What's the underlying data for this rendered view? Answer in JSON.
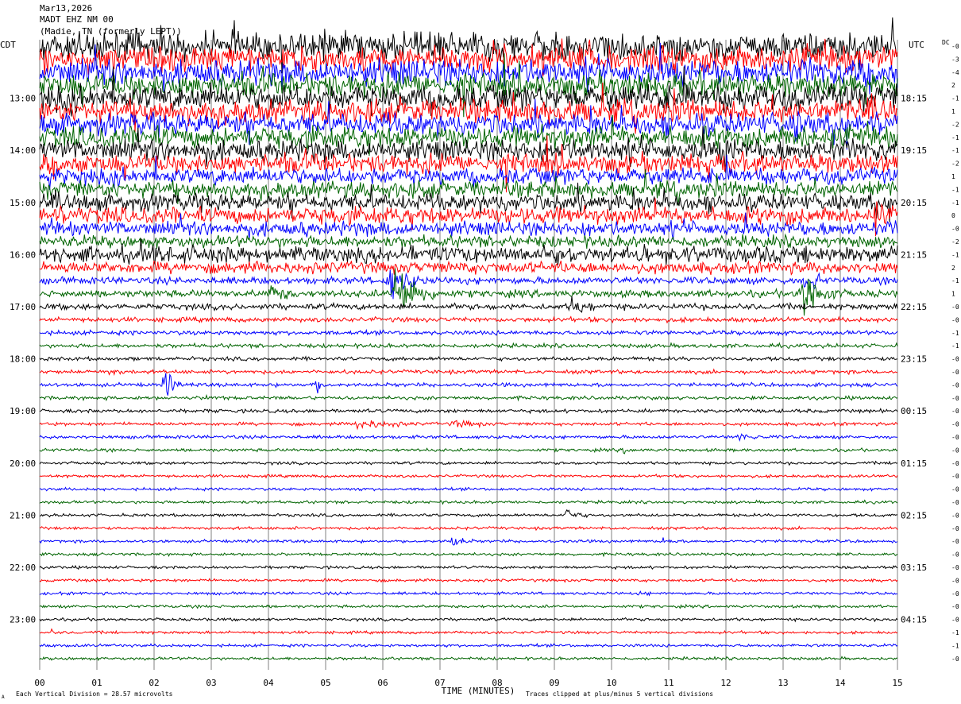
{
  "header": {
    "date": "Mar13,2026",
    "station": "MADT EHZ NM 00",
    "location": "(Madie, TN (formerly LEPT))"
  },
  "labels": {
    "left_tz": "CDT",
    "right_tz": "UTC",
    "dc": "DC",
    "x_axis_title": "TIME (MINUTES)",
    "scale_note": "Each Vertical Division =   28.57 microvolts",
    "clip_note": "Traces clipped at plus/minus 5 vertical divisions",
    "corner_mark": "A"
  },
  "colors": {
    "cycle": [
      "#000000",
      "#ff0000",
      "#0000ff",
      "#006400"
    ],
    "grid": "#808080"
  },
  "chart_data": {
    "type": "helicorder",
    "minutes_per_line": 15,
    "lines": 48,
    "x_ticks": [
      "00",
      "01",
      "02",
      "03",
      "04",
      "05",
      "06",
      "07",
      "08",
      "09",
      "10",
      "11",
      "12",
      "13",
      "14",
      "15"
    ],
    "xlim": [
      0,
      15
    ],
    "left_time_labels": [
      {
        "line": 4,
        "label": "13:00"
      },
      {
        "line": 8,
        "label": "14:00"
      },
      {
        "line": 12,
        "label": "15:00"
      },
      {
        "line": 16,
        "label": "16:00"
      },
      {
        "line": 20,
        "label": "17:00"
      },
      {
        "line": 24,
        "label": "18:00"
      },
      {
        "line": 28,
        "label": "19:00"
      },
      {
        "line": 32,
        "label": "20:00"
      },
      {
        "line": 36,
        "label": "21:00"
      },
      {
        "line": 40,
        "label": "22:00"
      },
      {
        "line": 44,
        "label": "23:00"
      }
    ],
    "right_time_labels": [
      {
        "line": 4,
        "label": "18:15"
      },
      {
        "line": 8,
        "label": "19:15"
      },
      {
        "line": 12,
        "label": "20:15"
      },
      {
        "line": 16,
        "label": "21:15"
      },
      {
        "line": 20,
        "label": "22:15"
      },
      {
        "line": 24,
        "label": "23:15"
      },
      {
        "line": 28,
        "label": "00:15"
      },
      {
        "line": 32,
        "label": "01:15"
      },
      {
        "line": 36,
        "label": "02:15"
      },
      {
        "line": 40,
        "label": "03:15"
      },
      {
        "line": 44,
        "label": "04:15"
      }
    ],
    "dc_offsets": [
      "-0",
      "-3",
      "-4",
      "2",
      "-1",
      "1",
      "-2",
      "-1",
      "-1",
      "-2",
      "1",
      "-1",
      "-1",
      "0",
      "-0",
      "-2",
      "-1",
      "2",
      "-1",
      "1",
      "-0",
      "-0",
      "-1",
      "-1",
      "-0",
      "-0",
      "-0",
      "-0",
      "-0",
      "-0",
      "-0",
      "-0",
      "-0",
      "-0",
      "-0",
      "-0",
      "-0",
      "-0",
      "-0",
      "-0",
      "-0",
      "-0",
      "-0",
      "-0",
      "-0",
      "-1",
      "-1",
      "-0"
    ],
    "noise_amplitude": [
      12,
      11,
      11,
      10,
      11,
      10,
      9,
      9,
      9,
      8,
      7,
      7,
      7,
      7,
      6,
      5,
      7,
      5,
      3,
      3,
      2.5,
      2,
      1.8,
      1.7,
      1.6,
      1.6,
      1.6,
      1.5,
      1.5,
      1.4,
      1.4,
      1.3,
      1.2,
      1.2,
      1.2,
      1.2,
      1.2,
      1.2,
      1.2,
      1.2,
      1.2,
      1.2,
      1.2,
      1.2,
      1.2,
      1.2,
      1.2,
      1.2
    ],
    "events": [
      {
        "line": 8,
        "minute": 11.9,
        "duration": 0.8,
        "amplitude": 22
      },
      {
        "line": 6,
        "minute": 13.2,
        "duration": 0.6,
        "amplitude": 20
      },
      {
        "line": 7,
        "minute": 13.3,
        "duration": 0.5,
        "amplitude": 15
      },
      {
        "line": 11,
        "minute": 14.5,
        "duration": 0.6,
        "amplitude": 15
      },
      {
        "line": 13,
        "minute": 11.1,
        "duration": 0.4,
        "amplitude": 18
      },
      {
        "line": 13,
        "minute": 14.6,
        "duration": 0.6,
        "amplitude": 18
      },
      {
        "line": 13,
        "minute": 13.0,
        "duration": 0.6,
        "amplitude": 12
      },
      {
        "line": 16,
        "minute": 10.9,
        "duration": 0.3,
        "amplitude": 18
      },
      {
        "line": 18,
        "minute": 6.1,
        "duration": 0.8,
        "amplitude": 20
      },
      {
        "line": 19,
        "minute": 6.2,
        "duration": 0.9,
        "amplitude": 30
      },
      {
        "line": 19,
        "minute": 13.3,
        "duration": 0.8,
        "amplitude": 28
      },
      {
        "line": 18,
        "minute": 13.4,
        "duration": 0.4,
        "amplitude": 20
      },
      {
        "line": 19,
        "minute": 4.0,
        "duration": 1.0,
        "amplitude": 10
      },
      {
        "line": 20,
        "minute": 9.3,
        "duration": 0.8,
        "amplitude": 10
      },
      {
        "line": 26,
        "minute": 2.2,
        "duration": 0.3,
        "amplitude": 18
      },
      {
        "line": 26,
        "minute": 4.8,
        "duration": 0.3,
        "amplitude": 10
      },
      {
        "line": 25,
        "minute": 1.2,
        "duration": 0.6,
        "amplitude": 5
      },
      {
        "line": 27,
        "minute": 2.9,
        "duration": 0.4,
        "amplitude": 5
      },
      {
        "line": 28,
        "minute": 12.2,
        "duration": 0.3,
        "amplitude": 4
      },
      {
        "line": 29,
        "minute": 5.5,
        "duration": 2.0,
        "amplitude": 5
      },
      {
        "line": 29,
        "minute": 7.2,
        "duration": 1.6,
        "amplitude": 4
      },
      {
        "line": 30,
        "minute": 12.2,
        "duration": 1.2,
        "amplitude": 4
      },
      {
        "line": 31,
        "minute": 10.2,
        "duration": 0.6,
        "amplitude": 4
      },
      {
        "line": 34,
        "minute": 5.5,
        "duration": 0.3,
        "amplitude": 3
      },
      {
        "line": 36,
        "minute": 9.2,
        "duration": 0.5,
        "amplitude": 8
      },
      {
        "line": 38,
        "minute": 7.2,
        "duration": 0.6,
        "amplitude": 6
      },
      {
        "line": 38,
        "minute": 10.9,
        "duration": 0.5,
        "amplitude": 4
      },
      {
        "line": 42,
        "minute": 10.5,
        "duration": 0.5,
        "amplitude": 3
      },
      {
        "line": 45,
        "minute": 0.2,
        "duration": 0.3,
        "amplitude": 3
      }
    ]
  }
}
